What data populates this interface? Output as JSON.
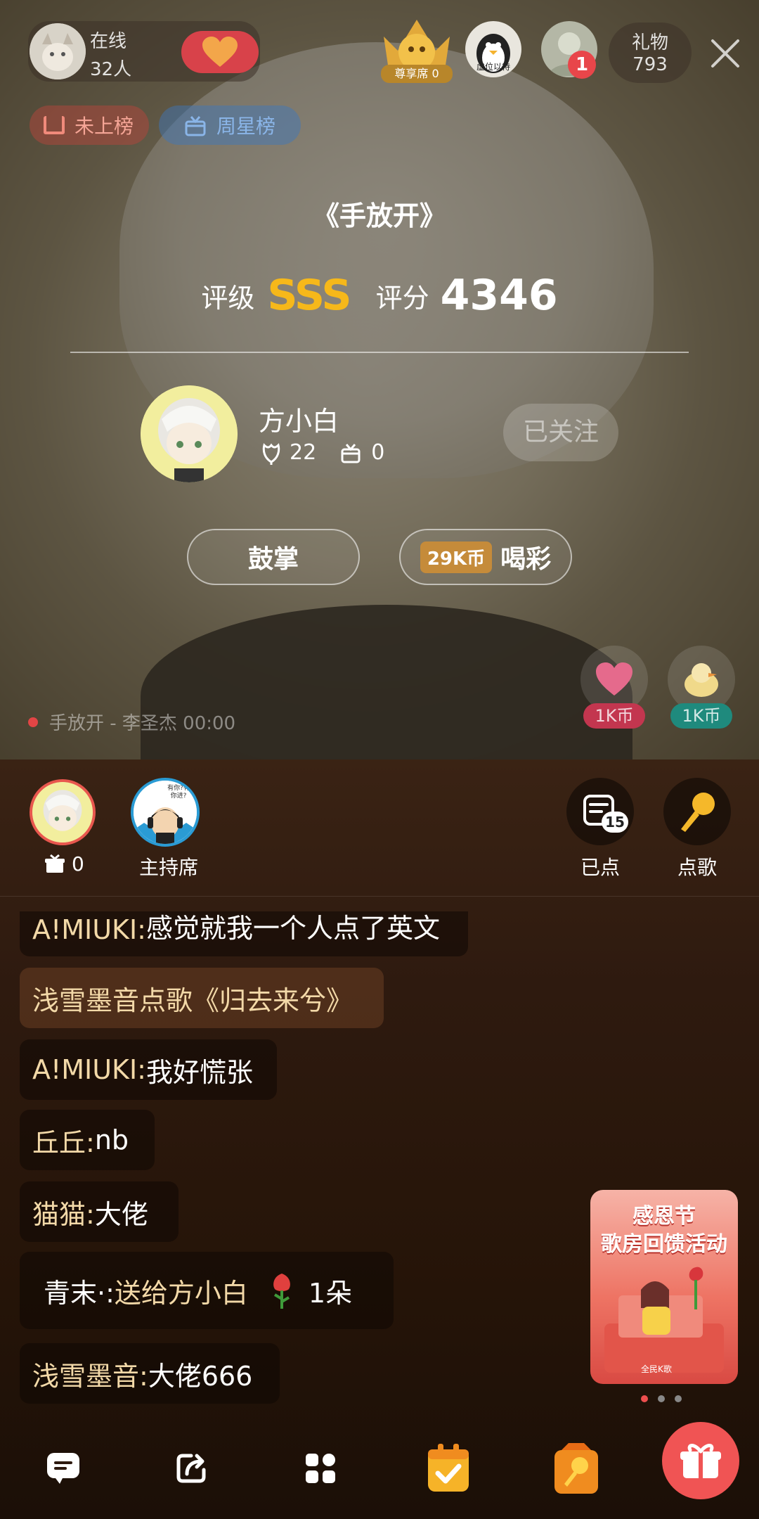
{
  "top": {
    "online_label": "在线",
    "online_count": "32人",
    "honor_seat_label": "尊享席 0",
    "penguin_label": "虚位以待",
    "notif_count": "1",
    "gift_label": "礼物",
    "gift_count": "793",
    "rank_chip": "未上榜",
    "weekly_chip": "周星榜"
  },
  "result": {
    "song_title": "《手放开》",
    "grade_label": "评级",
    "grade_value": "SSS",
    "score_label": "评分",
    "score_value": "4346",
    "singer_name": "方小白",
    "likes": "22",
    "gifts": "0",
    "follow_label": "已关注",
    "applaud_label": "鼓掌",
    "cheer_price": "29K币",
    "cheer_label": "喝彩"
  },
  "now_playing": "手放开 - 李圣杰 00:00",
  "quick_gifts": [
    {
      "price": "1K币"
    },
    {
      "price": "1K币"
    }
  ],
  "seats": {
    "singer_gift_count": "0",
    "host_label": "主持席",
    "host_avatar_text": "有你?有你进?",
    "ordered_label": "已点",
    "ordered_count": "15",
    "request_label": "点歌"
  },
  "chat": [
    {
      "name": "A!MIUKI: ",
      "text": "感觉就我一个人点了英文"
    },
    {
      "name": "浅雪墨音点歌《归去来兮》",
      "text": ""
    },
    {
      "name": "A!MIUKI: ",
      "text": "我好慌张"
    },
    {
      "name": "丘丘: ",
      "text": "nb"
    },
    {
      "name": "猫猫: ",
      "text": "大佬"
    },
    {
      "name": "青末·: ",
      "text": "送给方小白",
      "count": "1朵"
    },
    {
      "name": "浅雪墨音: ",
      "text": "大佬666"
    }
  ],
  "banner": {
    "line1": "感恩节",
    "line2": "歌房回馈活动",
    "brand": "全民K歌"
  },
  "colors": {
    "accent": "#f6b81a",
    "gift_button": "#f05454",
    "chat_name": "#f3d9a8"
  }
}
